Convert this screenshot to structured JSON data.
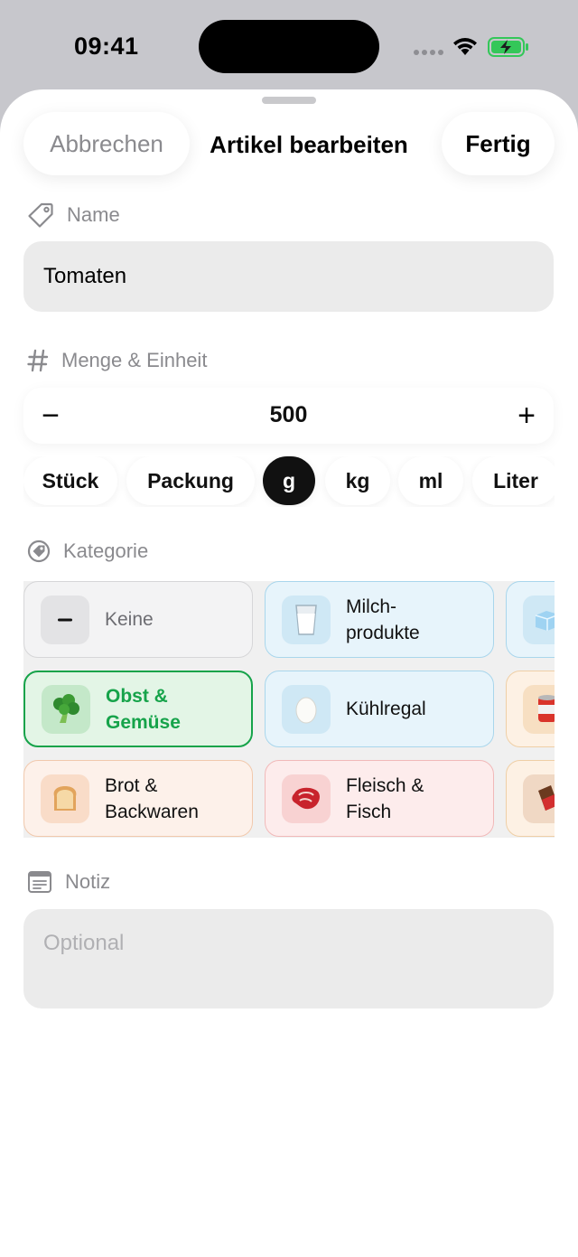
{
  "status_bar": {
    "time": "09:41"
  },
  "header": {
    "cancel_label": "Abbrechen",
    "title": "Artikel bearbeiten",
    "done_label": "Fertig"
  },
  "name_section": {
    "label": "Name",
    "value": "Tomaten"
  },
  "quantity_section": {
    "label": "Menge & Einheit",
    "minus": "−",
    "value": "500",
    "plus": "+",
    "units": [
      "Stück",
      "Packung",
      "g",
      "kg",
      "ml",
      "Liter"
    ],
    "selected_unit": "g"
  },
  "category_section": {
    "label": "Kategorie",
    "items": [
      {
        "label": "Keine",
        "icon": "minus-icon",
        "selected": false
      },
      {
        "label": "Milch-\nprodukte",
        "icon": "milk-glass-icon",
        "selected": false
      },
      {
        "label": "",
        "icon": "ice-cube-icon",
        "selected": false
      },
      {
        "label": "Obst &\nGemüse",
        "icon": "broccoli-icon",
        "selected": true
      },
      {
        "label": "Kühlregal",
        "icon": "egg-icon",
        "selected": false
      },
      {
        "label": "",
        "icon": "can-icon",
        "selected": false
      },
      {
        "label": "Brot &\nBackwaren",
        "icon": "bread-icon",
        "selected": false
      },
      {
        "label": "Fleisch &\nFisch",
        "icon": "steak-icon",
        "selected": false
      },
      {
        "label": "",
        "icon": "chocolate-icon",
        "selected": false
      }
    ]
  },
  "note_section": {
    "label": "Notiz",
    "placeholder": "Optional"
  },
  "colors": {
    "accent_green": "#16a34a",
    "dark": "#111111",
    "field_bg": "#ebebeb",
    "secondary_text": "#8a8a8e"
  }
}
